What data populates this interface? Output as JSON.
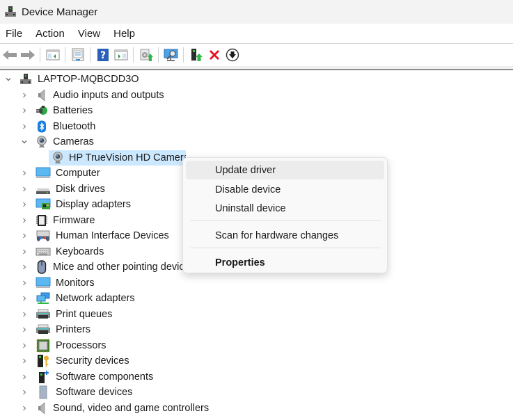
{
  "window": {
    "title": "Device Manager",
    "icon": "device-manager-icon"
  },
  "menubar": {
    "items": [
      "File",
      "Action",
      "View",
      "Help"
    ]
  },
  "toolbar": {
    "buttons": [
      {
        "name": "back-button",
        "icon": "arrow-left-icon"
      },
      {
        "name": "forward-button",
        "icon": "arrow-right-icon"
      },
      {
        "name": "show-hide-console-tree-button",
        "icon": "console-tree-icon"
      },
      {
        "name": "properties-button",
        "icon": "properties-icon"
      },
      {
        "name": "help-button",
        "icon": "help-icon"
      },
      {
        "name": "show-hide-action-pane-button",
        "icon": "action-pane-icon"
      },
      {
        "name": "update-driver-button",
        "icon": "update-driver-icon"
      },
      {
        "name": "scan-hardware-button",
        "icon": "scan-monitor-icon"
      },
      {
        "name": "enable-device-button",
        "icon": "enable-device-icon"
      },
      {
        "name": "uninstall-device-button",
        "icon": "red-x-icon"
      },
      {
        "name": "disable-device-button",
        "icon": "down-arrow-circle-icon"
      }
    ]
  },
  "tree": {
    "root": {
      "label": "LAPTOP-MQBCDD3O",
      "expanded": true,
      "icon": "computer-tower-icon"
    },
    "categories": [
      {
        "label": "Audio inputs and outputs",
        "icon": "speaker-icon",
        "expanded": false
      },
      {
        "label": "Batteries",
        "icon": "battery-plug-icon",
        "expanded": false
      },
      {
        "label": "Bluetooth",
        "icon": "bluetooth-icon",
        "expanded": false
      },
      {
        "label": "Cameras",
        "icon": "webcam-icon",
        "expanded": true,
        "children": [
          {
            "label": "HP TrueVision HD Camera",
            "icon": "webcam-icon",
            "selected": true
          }
        ]
      },
      {
        "label": "Computer",
        "icon": "monitor-icon",
        "expanded": false
      },
      {
        "label": "Disk drives",
        "icon": "disk-drive-icon",
        "expanded": false
      },
      {
        "label": "Display adapters",
        "icon": "display-adapter-icon",
        "expanded": false
      },
      {
        "label": "Firmware",
        "icon": "chip-icon",
        "expanded": false
      },
      {
        "label": "Human Interface Devices",
        "icon": "hid-icon",
        "expanded": false
      },
      {
        "label": "Keyboards",
        "icon": "keyboard-icon",
        "expanded": false
      },
      {
        "label": "Mice and other pointing devices",
        "icon": "mouse-icon",
        "expanded": false
      },
      {
        "label": "Monitors",
        "icon": "monitor-icon",
        "expanded": false
      },
      {
        "label": "Network adapters",
        "icon": "network-icon",
        "expanded": false
      },
      {
        "label": "Print queues",
        "icon": "printer-icon",
        "expanded": false
      },
      {
        "label": "Printers",
        "icon": "printer-icon",
        "expanded": false
      },
      {
        "label": "Processors",
        "icon": "processor-icon",
        "expanded": false
      },
      {
        "label": "Security devices",
        "icon": "security-key-icon",
        "expanded": false
      },
      {
        "label": "Software components",
        "icon": "software-component-icon",
        "expanded": false
      },
      {
        "label": "Software devices",
        "icon": "software-device-icon",
        "expanded": false
      },
      {
        "label": "Sound, video and game controllers",
        "icon": "speaker-icon",
        "expanded": false
      }
    ]
  },
  "context_menu": {
    "items": [
      {
        "label": "Update driver",
        "hover": true
      },
      {
        "label": "Disable device"
      },
      {
        "label": "Uninstall device"
      },
      {
        "separator": true
      },
      {
        "label": "Scan for hardware changes"
      },
      {
        "separator": true
      },
      {
        "label": "Properties",
        "bold": true
      }
    ]
  },
  "colors": {
    "selection": "#cce8ff",
    "menu_hover": "#ececec",
    "titlebar": "#f3f3f3",
    "uninstall_red": "#e81123"
  }
}
